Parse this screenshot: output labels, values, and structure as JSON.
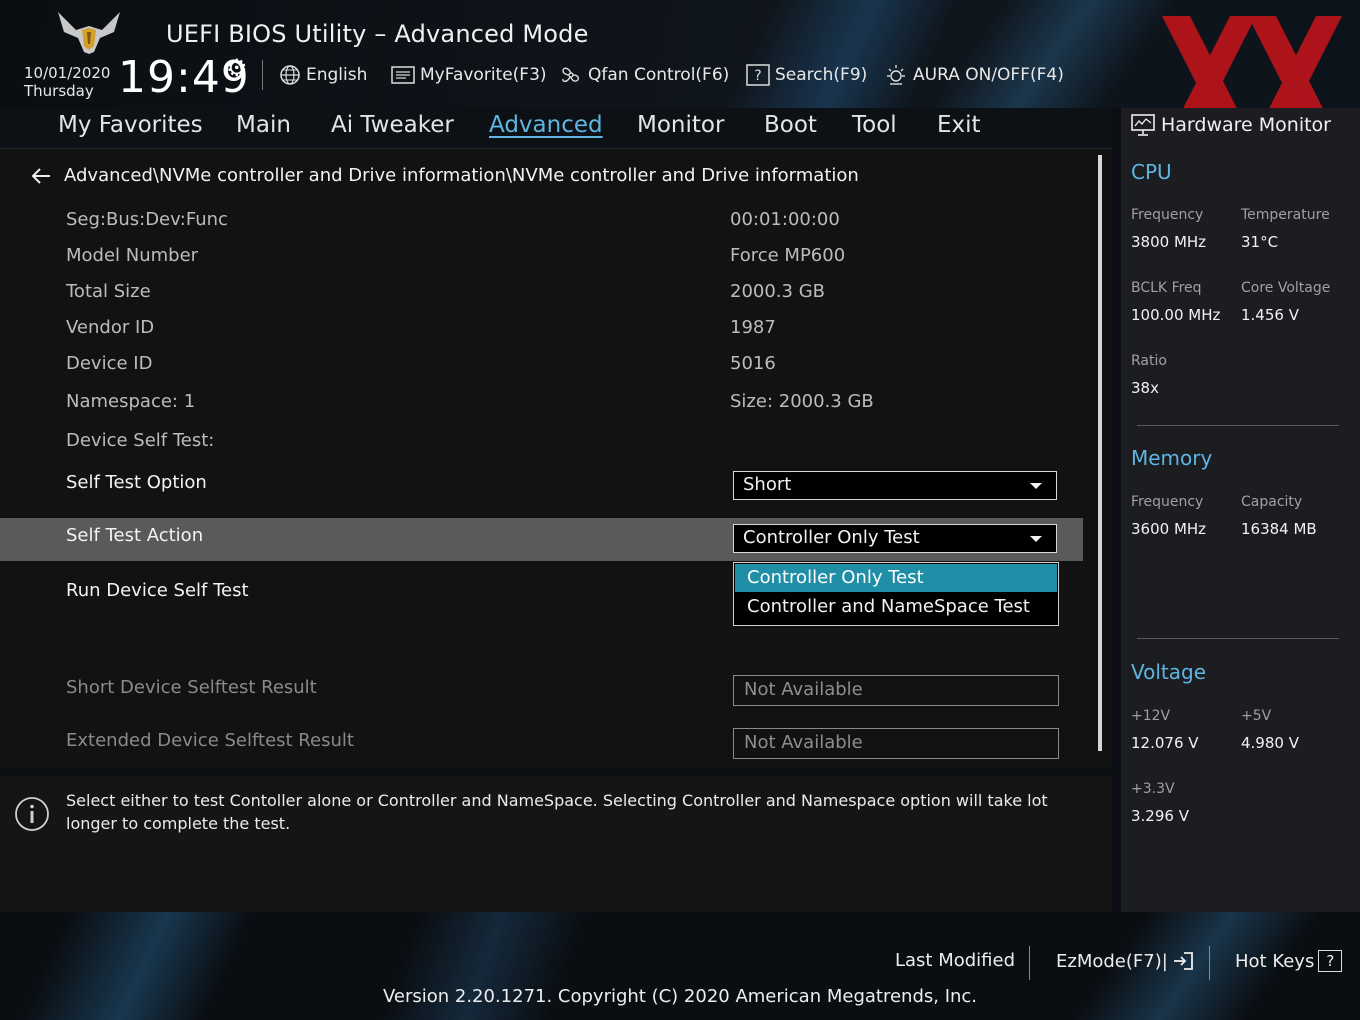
{
  "header": {
    "title": "UEFI BIOS Utility – Advanced Mode",
    "date": "10/01/2020",
    "day": "Thursday",
    "time": "19:49",
    "toolbar": {
      "language": "English",
      "favorite": "MyFavorite(F3)",
      "qfan": "Qfan Control(F6)",
      "search": "Search(F9)",
      "aura": "AURA ON/OFF(F4)"
    },
    "watermark": "XX"
  },
  "nav": {
    "tabs": [
      "My Favorites",
      "Main",
      "Ai Tweaker",
      "Advanced",
      "Monitor",
      "Boot",
      "Tool",
      "Exit"
    ],
    "active": "Advanced"
  },
  "main": {
    "breadcrumb": "Advanced\\NVMe controller and Drive information\\NVMe controller and Drive information",
    "info": [
      {
        "label": "Seg:Bus:Dev:Func",
        "value": "00:01:00:00"
      },
      {
        "label": "Model Number",
        "value": "Force MP600"
      },
      {
        "label": "Total Size",
        "value": "2000.3 GB"
      },
      {
        "label": "Vendor ID",
        "value": "1987"
      },
      {
        "label": "Device ID",
        "value": "5016"
      },
      {
        "label": "Namespace: 1",
        "value": "Size: 2000.3 GB"
      }
    ],
    "self_test_heading": "Device Self Test:",
    "self_test_option": {
      "label": "Self Test Option",
      "value": "Short"
    },
    "self_test_action": {
      "label": "Self Test Action",
      "value": "Controller Only Test"
    },
    "dropdown_options": [
      "Controller Only Test",
      "Controller and NameSpace Test"
    ],
    "run_self_test": "Run Device Self Test",
    "short_result": {
      "label": "Short Device Selftest Result",
      "value": "Not Available"
    },
    "extended_result": {
      "label": "Extended Device Selftest Result",
      "value": "Not Available"
    }
  },
  "help": {
    "text": "Select either to test Contoller alone or Controller and NameSpace. Selecting Controller and Namespace option will take lot longer to complete the test."
  },
  "hw_monitor": {
    "title": "Hardware Monitor",
    "cpu": {
      "heading": "CPU",
      "frequency_label": "Frequency",
      "frequency": "3800 MHz",
      "temperature_label": "Temperature",
      "temperature": "31°C",
      "bclk_label": "BCLK Freq",
      "bclk": "100.00 MHz",
      "core_voltage_label": "Core Voltage",
      "core_voltage": "1.456 V",
      "ratio_label": "Ratio",
      "ratio": "38x"
    },
    "memory": {
      "heading": "Memory",
      "frequency_label": "Frequency",
      "frequency": "3600 MHz",
      "capacity_label": "Capacity",
      "capacity": "16384 MB"
    },
    "voltage": {
      "heading": "Voltage",
      "v12_label": "+12V",
      "v12": "12.076 V",
      "v5_label": "+5V",
      "v5": "4.980 V",
      "v33_label": "+3.3V",
      "v33": "3.296 V"
    }
  },
  "footer": {
    "last_modified": "Last Modified",
    "ezmode": "EzMode(F7)|",
    "hotkeys": "Hot Keys",
    "hotkeys_icon": "?",
    "version": "Version 2.20.1271. Copyright (C) 2020 American Megatrends, Inc."
  }
}
